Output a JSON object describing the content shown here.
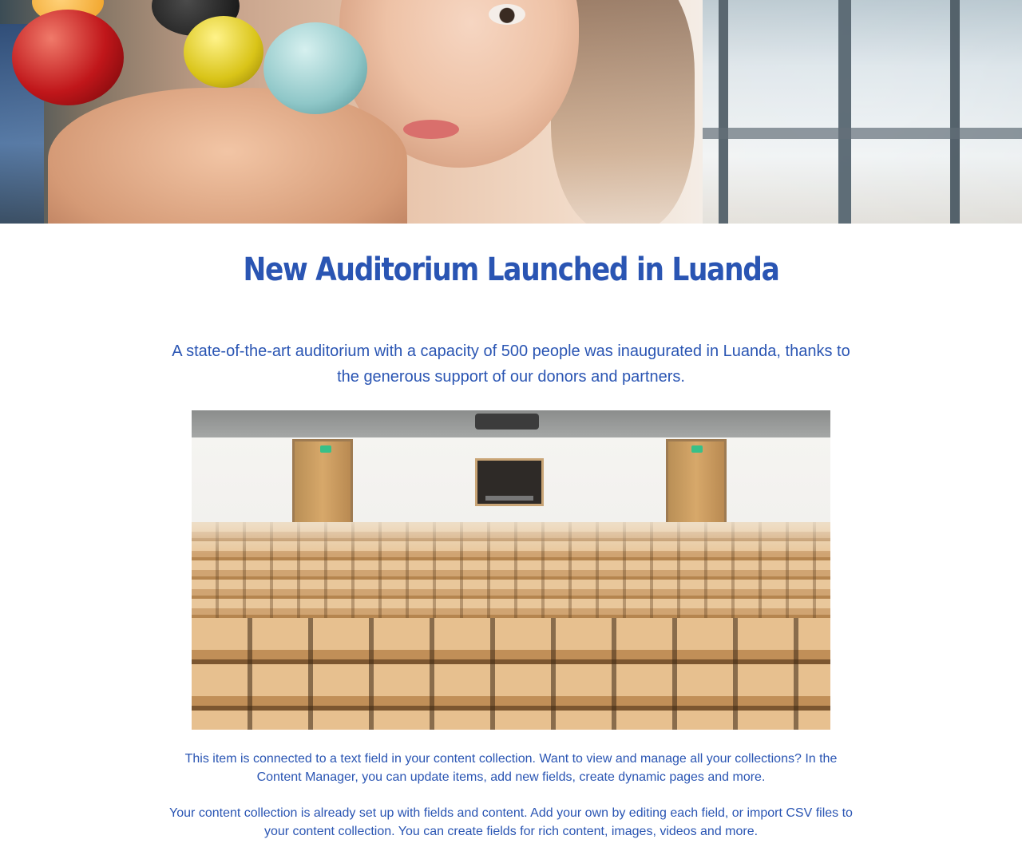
{
  "article": {
    "title": "New Auditorium Launched in Luanda",
    "summary": "A state-of-the-art auditorium with a capacity of 500 people was inaugurated in Luanda, thanks to the generous support of our donors and partners.",
    "body": [
      "This item is connected to a text field in your content collection. Want to view and manage all your collections? In the Content Manager, you can update items, add new fields, create dynamic pages and more.",
      "Your content collection is already set up with fields and content. Add your own by editing each field, or import CSV files to your content collection. You can create fields for rich content, images, videos and more."
    ]
  },
  "colors": {
    "accent": "#2a55b3",
    "background": "#ffffff"
  }
}
